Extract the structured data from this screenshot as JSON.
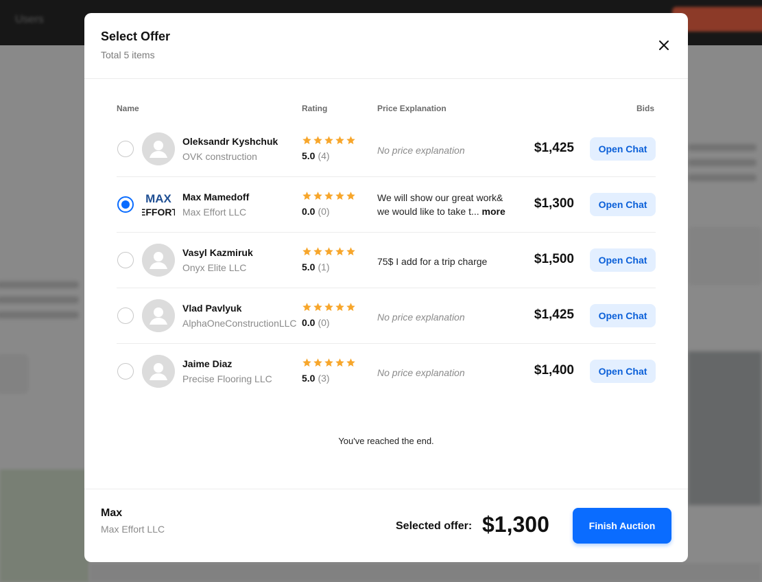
{
  "modal": {
    "title": "Select Offer",
    "subtitle": "Total 5 items"
  },
  "columns": {
    "name": "Name",
    "rating": "Rating",
    "price": "Price Explanation",
    "bids": "Bids"
  },
  "offers": [
    {
      "name": "Oleksandr Kyshchuk",
      "company": "OVK construction",
      "rating": "5.0",
      "count": "(4)",
      "stars": 5,
      "explanation": "No price explanation",
      "bid": "$1,425",
      "chat": "Open Chat",
      "selected": false
    },
    {
      "name": "Max Mamedoff",
      "company": "Max Effort LLC",
      "rating": "0.0",
      "count": "(0)",
      "stars": 5,
      "explanation": "We will show our great work& we would like to take t...",
      "more": "more",
      "bid": "$1,300",
      "chat": "Open Chat",
      "selected": true,
      "logo_text": {
        "top": "MAX",
        "bottom": "EFFORT"
      }
    },
    {
      "name": "Vasyl Kazmiruk",
      "company": "Onyx Elite LLC",
      "rating": "5.0",
      "count": "(1)",
      "stars": 5,
      "explanation": "75$ I add for a trip charge",
      "bid": "$1,500",
      "chat": "Open Chat",
      "selected": false
    },
    {
      "name": "Vlad Pavlyuk",
      "company": "AlphaOneConstructionLLC",
      "rating": "0.0",
      "count": "(0)",
      "stars": 5,
      "explanation": "No price explanation",
      "bid": "$1,425",
      "chat": "Open Chat",
      "selected": false
    },
    {
      "name": "Jaime Diaz",
      "company": "Precise Flooring LLC",
      "rating": "5.0",
      "count": "(3)",
      "stars": 5,
      "explanation": "No price explanation",
      "bid": "$1,400",
      "chat": "Open Chat",
      "selected": false
    }
  ],
  "end_message": "You've reached the end.",
  "footer": {
    "selected_name": "Max",
    "selected_company": "Max Effort LLC",
    "selected_label": "Selected offer:",
    "selected_amount": "$1,300",
    "finish_label": "Finish Auction"
  },
  "background": {
    "nav_item": "Users"
  },
  "colors": {
    "accent": "#0a6cff",
    "star": "#f7a62b",
    "chat_bg": "#e3efff"
  }
}
